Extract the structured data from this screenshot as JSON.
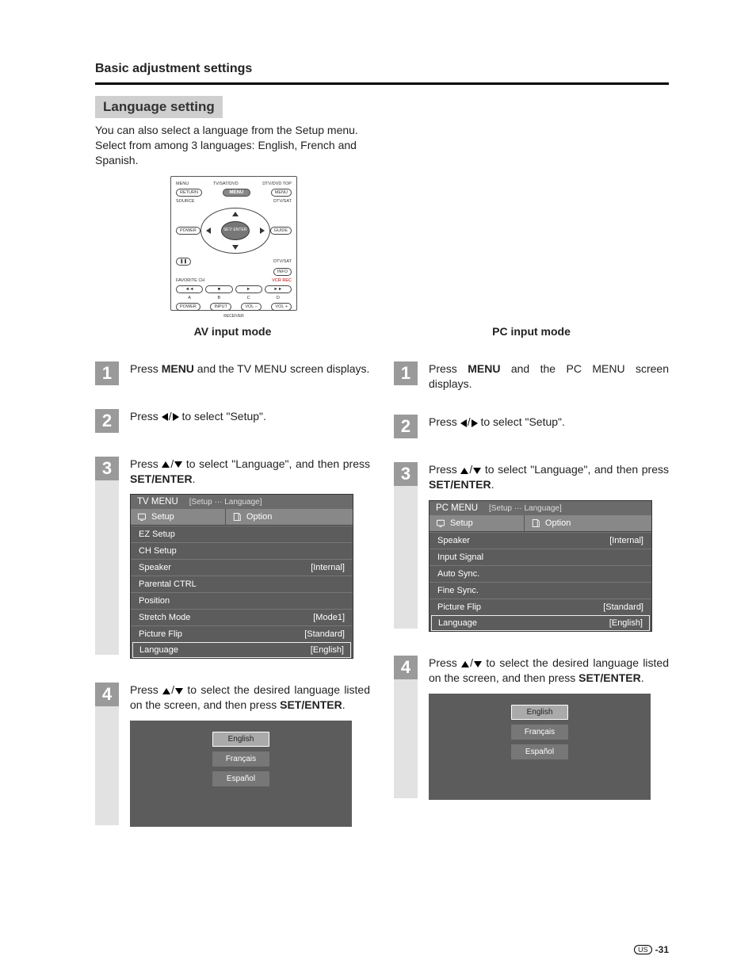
{
  "header": {
    "section_title": "Basic adjustment settings",
    "box_label": "Language setting",
    "intro": "You can also select a language from the Setup menu. Select from among 3 languages: English, French and Spanish."
  },
  "remote": {
    "row1": {
      "left_lbl": "MENU",
      "center_lbl": "TV/SAT/DVD",
      "right_lbl": "DTV/DVD TOP"
    },
    "row1_btns": {
      "left": "RETURN",
      "center": "MENU",
      "right": "MENU"
    },
    "row2": {
      "left_lbl": "SOURCE",
      "right_lbl": "DTV/SAT"
    },
    "row2_btns": {
      "left": "POWER",
      "right": "GUIDE"
    },
    "center_btn": "SET/\nENTER",
    "row3": {
      "right_lbl": "DTV/SAT",
      "right_btn": "INFO"
    },
    "fav_lbl": "FAVORITE CH",
    "vcr_lbl": "VCR REC",
    "transport_letters": [
      "A",
      "B",
      "C",
      "D"
    ],
    "bottom": {
      "power": "POWER",
      "input": "INPUT",
      "volm": "VOL −",
      "volp": "VOL +"
    },
    "receiver_lbl": "RECEIVER"
  },
  "av": {
    "mode_title": "AV input mode",
    "steps": {
      "s1_pre": "Press ",
      "s1_bold": "MENU",
      "s1_post": " and the TV MENU screen displays.",
      "s2_pre": "Press ",
      "s2_post": " to select \"Setup\".",
      "s3_pre": "Press ",
      "s3_mid": " to select \"Language\", and then press ",
      "s3_bold": "SET/ENTER",
      "s3_end": ".",
      "s4_pre": "Press ",
      "s4_mid": " to select the desired language listed on the screen, and then press ",
      "s4_bold": "SET/ENTER",
      "s4_end": "."
    },
    "menu": {
      "title": "TV MENU",
      "crumb": "[Setup ··· Language]",
      "tab1": "Setup",
      "tab2": "Option",
      "rows": [
        {
          "label": "EZ Setup",
          "value": ""
        },
        {
          "label": "CH Setup",
          "value": ""
        },
        {
          "label": "Speaker",
          "value": "[Internal]"
        },
        {
          "label": "Parental CTRL",
          "value": ""
        },
        {
          "label": "Position",
          "value": ""
        },
        {
          "label": "Stretch Mode",
          "value": "[Mode1]"
        },
        {
          "label": "Picture Flip",
          "value": "[Standard]"
        },
        {
          "label": "Language",
          "value": "[English]",
          "sel": true
        }
      ]
    },
    "lang_opts": [
      "English",
      "Français",
      "Español"
    ]
  },
  "pc": {
    "mode_title": "PC input mode",
    "steps": {
      "s1_pre": "Press ",
      "s1_bold": "MENU",
      "s1_post": " and the PC MENU screen displays.",
      "s2_pre": "Press ",
      "s2_post": " to select \"Setup\".",
      "s3_pre": "Press ",
      "s3_mid": " to select \"Language\", and then press ",
      "s3_bold": "SET/ENTER",
      "s3_end": ".",
      "s4_pre": "Press ",
      "s4_mid": " to select the desired language listed on the screen, and then press ",
      "s4_bold": "SET/ENTER",
      "s4_end": "."
    },
    "menu": {
      "title": "PC MENU",
      "crumb": "[Setup ··· Language]",
      "tab1": "Setup",
      "tab2": "Option",
      "rows": [
        {
          "label": "Speaker",
          "value": "[Internal]"
        },
        {
          "label": "Input Signal",
          "value": ""
        },
        {
          "label": "Auto Sync.",
          "value": ""
        },
        {
          "label": "Fine Sync.",
          "value": ""
        },
        {
          "label": "Picture Flip",
          "value": "[Standard]"
        },
        {
          "label": "Language",
          "value": "[English]",
          "sel": true
        }
      ]
    },
    "lang_opts": [
      "English",
      "Français",
      "Español"
    ]
  },
  "footer": {
    "region": "US",
    "page": "-31"
  }
}
